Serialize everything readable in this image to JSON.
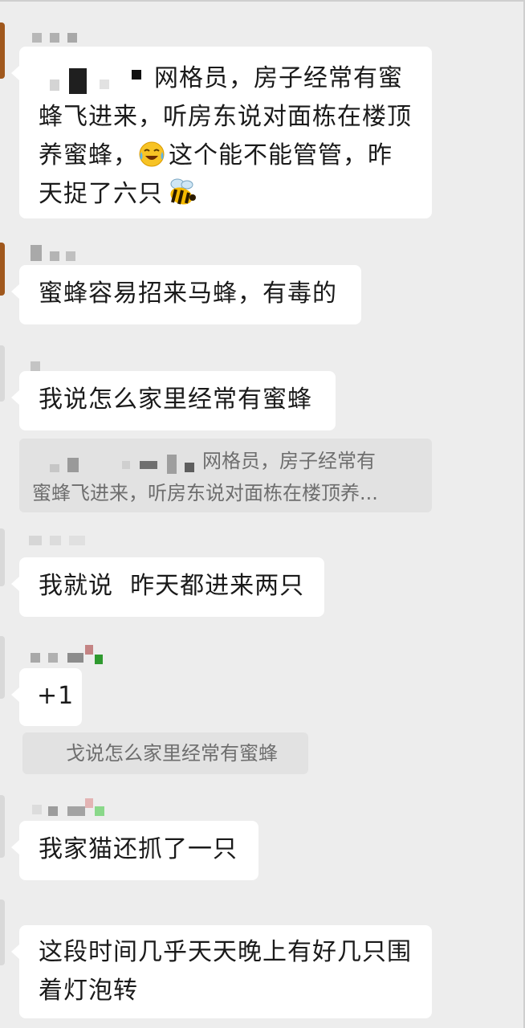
{
  "messages": [
    {
      "text_line1_suffix": "网格员，房子经常有蜜",
      "text_line2": "蜂飞进来，听房东说对面栋在楼顶",
      "text_line3_a": "养蜜蜂，",
      "text_line3_b": "这个能不能管管，昨",
      "text_line4": "天捉了六只",
      "emoji_laugh": "laughing-crying-icon",
      "emoji_bee": "bee-icon"
    },
    {
      "text": "蜜蜂容易招来马蜂，有毒的"
    },
    {
      "text": "我说怎么家里经常有蜜蜂",
      "quote_line1_suffix": "网格员，房子经常有",
      "quote_line2": "蜜蜂飞进来，听房东说对面栋在楼顶养..."
    },
    {
      "text": "我就说  昨天都进来两只"
    },
    {
      "text": "+1",
      "quote": "戈说怎么家里经常有蜜蜂"
    },
    {
      "text": "我家猫还抓了一只"
    },
    {
      "text_line1": "这段时间几乎天天晚上有好几只围",
      "text_line2": "着灯泡转"
    }
  ],
  "colors": {
    "background": "#ededed",
    "bubble": "#ffffff",
    "quote_bg": "#e2e2e2",
    "avatar_brown": "#a0581d"
  }
}
